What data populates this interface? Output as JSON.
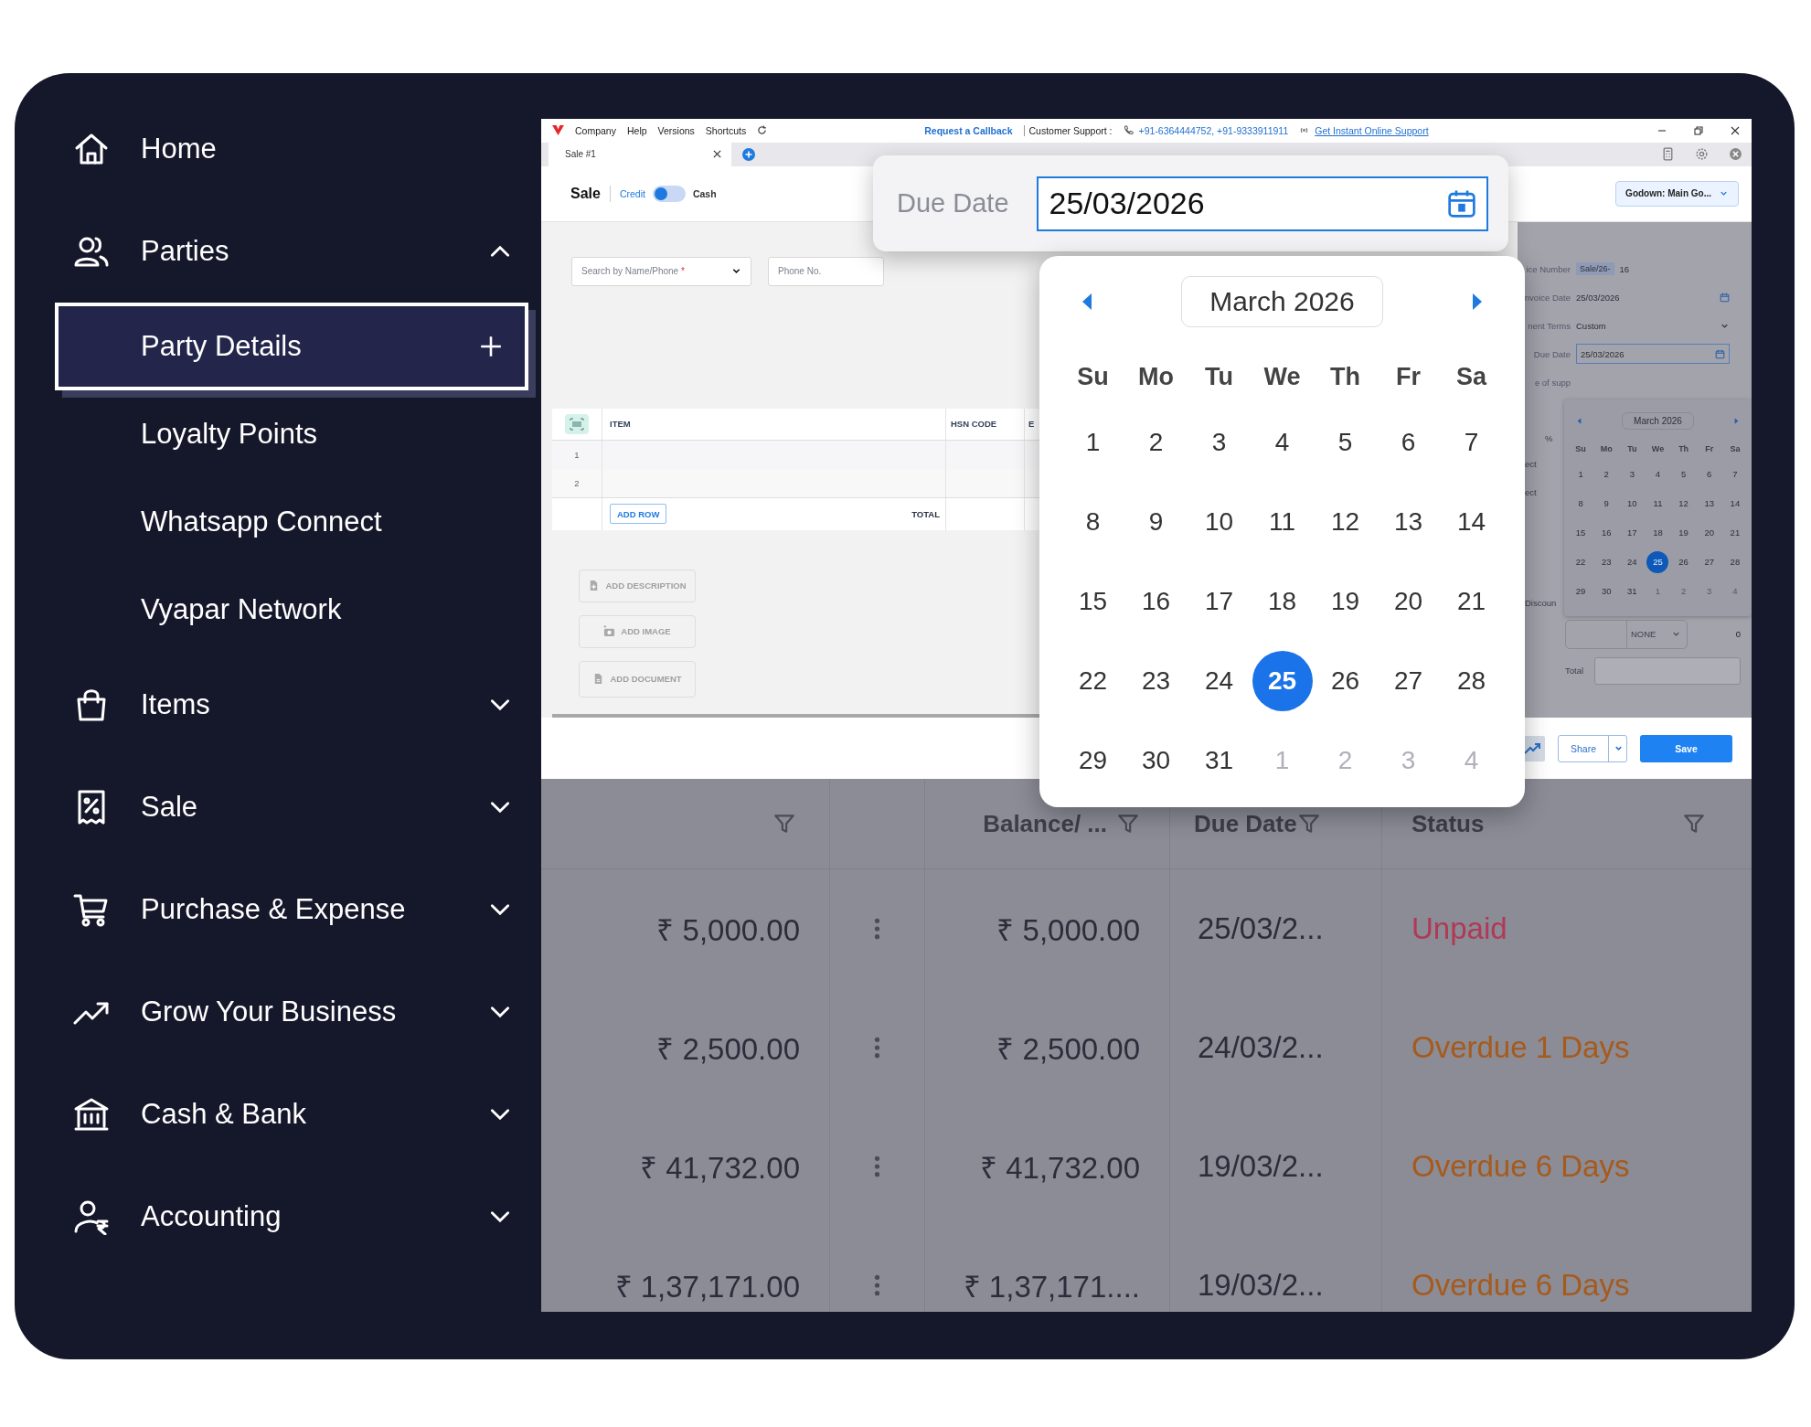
{
  "sidebar": {
    "items": [
      {
        "label": "Home",
        "kind": "link"
      },
      {
        "label": "Parties",
        "kind": "group",
        "expanded": true,
        "children": [
          {
            "label": "Party Details",
            "selected": true,
            "add_button": true
          },
          {
            "label": "Loyalty Points",
            "selected": false,
            "add_button": false
          },
          {
            "label": "Whatsapp Connect",
            "selected": false,
            "add_button": false
          },
          {
            "label": "Vyapar Network",
            "selected": false,
            "add_button": false
          }
        ]
      },
      {
        "label": "Items",
        "kind": "group",
        "expanded": false
      },
      {
        "label": "Sale",
        "kind": "group",
        "expanded": false
      },
      {
        "label": "Purchase & Expense",
        "kind": "group",
        "expanded": false
      },
      {
        "label": "Grow Your Business",
        "kind": "group",
        "expanded": false
      },
      {
        "label": "Cash & Bank",
        "kind": "group",
        "expanded": false
      },
      {
        "label": "Accounting",
        "kind": "group",
        "expanded": false
      }
    ]
  },
  "app_window": {
    "menu": [
      "Company",
      "Help",
      "Versions",
      "Shortcuts"
    ],
    "callback_link": "Request a Callback",
    "support_label": "Customer Support :",
    "support_phones": "+91-6364444752, +91-9333911911",
    "online_support_link": "Get Instant Online Support",
    "tabs": [
      {
        "label": "Sale #1",
        "selected": true
      }
    ],
    "title": "Sale",
    "payment_toggle": {
      "credit_label": "Credit",
      "cash_label": "Cash",
      "cash_selected": false
    },
    "godown": "Godown: Main Go...",
    "party_field": {
      "placeholder": "Search by Name/Phone",
      "required_mark": "*"
    },
    "phone_field": {
      "placeholder": "Phone No."
    },
    "items_table": {
      "columns": [
        "ITEM",
        "HSN CODE",
        "E"
      ],
      "rows": [
        "1",
        "2"
      ],
      "add_row": "ADD ROW",
      "total_label": "TOTAL"
    },
    "attachments": [
      "ADD DESCRIPTION",
      "ADD IMAGE",
      "ADD DOCUMENT"
    ],
    "details": {
      "invoice_number_label": "ice Number",
      "invoice_prefix": "Sale/26-",
      "invoice_number": "16",
      "invoice_date_label": "nvoice Date",
      "invoice_date": "25/03/2026",
      "terms_label": "nent Terms",
      "terms": "Custom",
      "due_date_label": "Due Date",
      "due_date": "25/03/2026",
      "supply_label": "e of supp",
      "tax_header": "%",
      "tax_rows": [
        "ect",
        "ect"
      ],
      "discount_label": "Discoun",
      "discount_unit": "NONE",
      "discount_value": "0",
      "total_label": "Total"
    },
    "mini_calendar": {
      "month": "March 2026",
      "weekdays": [
        "Su",
        "Mo",
        "Tu",
        "We",
        "Th",
        "Fr",
        "Sa"
      ],
      "days": [
        {
          "day": "1",
          "muted": false,
          "selected": false
        },
        {
          "day": "2",
          "muted": false,
          "selected": false
        },
        {
          "day": "3",
          "muted": false,
          "selected": false
        },
        {
          "day": "4",
          "muted": false,
          "selected": false
        },
        {
          "day": "5",
          "muted": false,
          "selected": false
        },
        {
          "day": "6",
          "muted": false,
          "selected": false
        },
        {
          "day": "7",
          "muted": false,
          "selected": false
        },
        {
          "day": "8",
          "muted": false,
          "selected": false
        },
        {
          "day": "9",
          "muted": false,
          "selected": false
        },
        {
          "day": "10",
          "muted": false,
          "selected": false
        },
        {
          "day": "11",
          "muted": false,
          "selected": false
        },
        {
          "day": "12",
          "muted": false,
          "selected": false
        },
        {
          "day": "13",
          "muted": false,
          "selected": false
        },
        {
          "day": "14",
          "muted": false,
          "selected": false
        },
        {
          "day": "15",
          "muted": false,
          "selected": false
        },
        {
          "day": "16",
          "muted": false,
          "selected": false
        },
        {
          "day": "17",
          "muted": false,
          "selected": false
        },
        {
          "day": "18",
          "muted": false,
          "selected": false
        },
        {
          "day": "19",
          "muted": false,
          "selected": false
        },
        {
          "day": "20",
          "muted": false,
          "selected": false
        },
        {
          "day": "21",
          "muted": false,
          "selected": false
        },
        {
          "day": "22",
          "muted": false,
          "selected": false
        },
        {
          "day": "23",
          "muted": false,
          "selected": false
        },
        {
          "day": "24",
          "muted": false,
          "selected": false
        },
        {
          "day": "25",
          "muted": false,
          "selected": true
        },
        {
          "day": "26",
          "muted": false,
          "selected": false
        },
        {
          "day": "27",
          "muted": false,
          "selected": false
        },
        {
          "day": "28",
          "muted": false,
          "selected": false
        },
        {
          "day": "29",
          "muted": false,
          "selected": false
        },
        {
          "day": "30",
          "muted": false,
          "selected": false
        },
        {
          "day": "31",
          "muted": false,
          "selected": false
        },
        {
          "day": "1",
          "muted": true,
          "selected": false
        },
        {
          "day": "2",
          "muted": true,
          "selected": false
        },
        {
          "day": "3",
          "muted": true,
          "selected": false
        },
        {
          "day": "4",
          "muted": true,
          "selected": false
        }
      ]
    },
    "share_button": "Share",
    "save_button": "Save"
  },
  "due_date_popup": {
    "label": "Due Date",
    "value": "25/03/2026",
    "calendar": {
      "month": "March 2026",
      "weekdays": [
        "Su",
        "Mo",
        "Tu",
        "We",
        "Th",
        "Fr",
        "Sa"
      ],
      "days": [
        {
          "day": "1",
          "muted": false,
          "selected": false
        },
        {
          "day": "2",
          "muted": false,
          "selected": false
        },
        {
          "day": "3",
          "muted": false,
          "selected": false
        },
        {
          "day": "4",
          "muted": false,
          "selected": false
        },
        {
          "day": "5",
          "muted": false,
          "selected": false
        },
        {
          "day": "6",
          "muted": false,
          "selected": false
        },
        {
          "day": "7",
          "muted": false,
          "selected": false
        },
        {
          "day": "8",
          "muted": false,
          "selected": false
        },
        {
          "day": "9",
          "muted": false,
          "selected": false
        },
        {
          "day": "10",
          "muted": false,
          "selected": false
        },
        {
          "day": "11",
          "muted": false,
          "selected": false
        },
        {
          "day": "12",
          "muted": false,
          "selected": false
        },
        {
          "day": "13",
          "muted": false,
          "selected": false
        },
        {
          "day": "14",
          "muted": false,
          "selected": false
        },
        {
          "day": "15",
          "muted": false,
          "selected": false
        },
        {
          "day": "16",
          "muted": false,
          "selected": false
        },
        {
          "day": "17",
          "muted": false,
          "selected": false
        },
        {
          "day": "18",
          "muted": false,
          "selected": false
        },
        {
          "day": "19",
          "muted": false,
          "selected": false
        },
        {
          "day": "20",
          "muted": false,
          "selected": false
        },
        {
          "day": "21",
          "muted": false,
          "selected": false
        },
        {
          "day": "22",
          "muted": false,
          "selected": false
        },
        {
          "day": "23",
          "muted": false,
          "selected": false
        },
        {
          "day": "24",
          "muted": false,
          "selected": false
        },
        {
          "day": "25",
          "muted": false,
          "selected": true
        },
        {
          "day": "26",
          "muted": false,
          "selected": false
        },
        {
          "day": "27",
          "muted": false,
          "selected": false
        },
        {
          "day": "28",
          "muted": false,
          "selected": false
        },
        {
          "day": "29",
          "muted": false,
          "selected": false
        },
        {
          "day": "30",
          "muted": false,
          "selected": false
        },
        {
          "day": "31",
          "muted": false,
          "selected": false
        },
        {
          "day": "1",
          "muted": true,
          "selected": false
        },
        {
          "day": "2",
          "muted": true,
          "selected": false
        },
        {
          "day": "3",
          "muted": true,
          "selected": false
        },
        {
          "day": "4",
          "muted": true,
          "selected": false
        }
      ]
    }
  },
  "ledger_table": {
    "columns": [
      {
        "kind": "filter"
      },
      {
        "kind": "actions"
      },
      {
        "label": "Balance/ ...",
        "kind": "filter"
      },
      {
        "label": "Due Date",
        "kind": "filter"
      },
      {
        "label": "Status",
        "kind": "filter"
      }
    ],
    "rows": [
      {
        "amount": "₹ 5,000.00",
        "balance": "₹ 5,000.00",
        "due_date": "25/03/2...",
        "status": "Unpaid",
        "color": "#b03a55"
      },
      {
        "amount": "₹ 2,500.00",
        "balance": "₹ 2,500.00",
        "due_date": "24/03/2...",
        "status": "Overdue 1 Days",
        "color": "#a65a1c"
      },
      {
        "amount": "₹ 41,732.00",
        "balance": "₹ 41,732.00",
        "due_date": "19/03/2...",
        "status": "Overdue 6 Days",
        "color": "#a65a1c"
      },
      {
        "amount": "₹ 1,37,171.00",
        "balance": "₹ 1,37,171....",
        "due_date": "19/03/2...",
        "status": "Overdue 6 Days",
        "color": "#a65a1c"
      }
    ]
  }
}
